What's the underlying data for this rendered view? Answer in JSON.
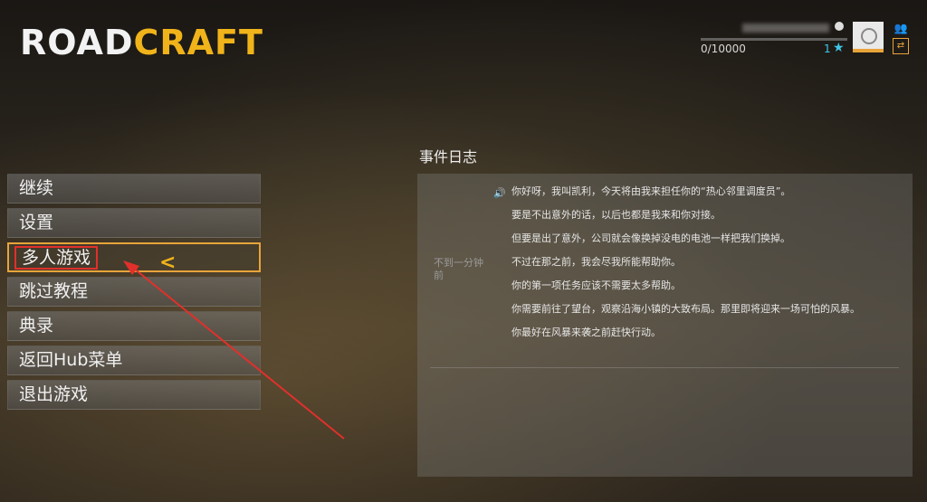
{
  "logo": {
    "part1": "ROAD",
    "part2": "CRAFT"
  },
  "profile": {
    "xp_text": "0/10000",
    "xp_fraction": 0.0,
    "level": "1",
    "icons": [
      "steam-icon",
      "star-icon",
      "friends-icon",
      "switch-icon"
    ]
  },
  "menu": {
    "items": [
      {
        "label": "继续"
      },
      {
        "label": "设置"
      },
      {
        "label": "多人游戏"
      },
      {
        "label": "跳过教程"
      },
      {
        "label": "典录"
      },
      {
        "label": "返回Hub菜单"
      },
      {
        "label": "退出游戏"
      }
    ],
    "selected_index": 2
  },
  "event_log": {
    "title": "事件日志",
    "time": "不到一分钟前",
    "lines": [
      "你好呀，我叫凯利，今天将由我来担任你的“热心邻里调度员”。",
      "要是不出意外的话，以后也都是我来和你对接。",
      "但要是出了意外，公司就会像换掉没电的电池一样把我们换掉。",
      "不过在那之前，我会尽我所能帮助你。",
      "你的第一项任务应该不需要太多帮助。",
      "你需要前往了望台，观察沿海小镇的大致布局。那里即将迎来一场可怕的风暴。",
      "你最好在风暴来袭之前赶快行动。"
    ]
  },
  "colors": {
    "accent": "#e8a43a",
    "logo_yellow": "#f0b31a",
    "annotation_red": "#e1302b",
    "level_blue": "#3fc7e8"
  }
}
